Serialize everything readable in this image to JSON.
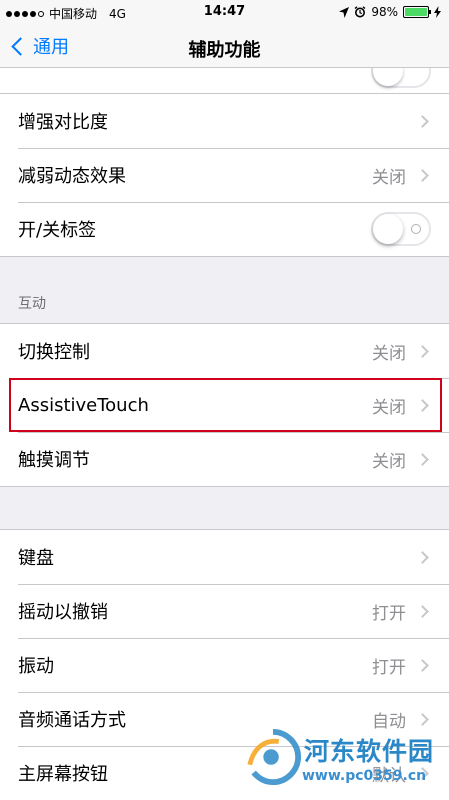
{
  "status_bar": {
    "carrier": "中国移动",
    "network": "4G",
    "time": "14:47",
    "battery_percent": "98%",
    "battery_level": 0.98
  },
  "nav": {
    "back_label": "通用",
    "title": "辅助功能"
  },
  "display_group": {
    "rows": [
      {
        "label": "增强对比度",
        "value": ""
      },
      {
        "label": "减弱动态效果",
        "value": "关闭"
      },
      {
        "label": "开/关标签",
        "toggle": false
      }
    ]
  },
  "interaction_group": {
    "header": "互动",
    "rows": [
      {
        "label": "切换控制",
        "value": "关闭"
      },
      {
        "label": "AssistiveTouch",
        "value": "关闭"
      },
      {
        "label": "触摸调节",
        "value": "关闭"
      }
    ]
  },
  "other_group": {
    "rows": [
      {
        "label": "键盘",
        "value": ""
      },
      {
        "label": "摇动以撤销",
        "value": "打开"
      },
      {
        "label": "振动",
        "value": "打开"
      },
      {
        "label": "音频通话方式",
        "value": "自动"
      },
      {
        "label": "主屏幕按钮",
        "value": "默认"
      }
    ]
  },
  "watermark": {
    "title": "河东软件园",
    "url": "www.pc0359.cn"
  },
  "colors": {
    "accent": "#007aff",
    "highlight_border": "#d0021b",
    "battery": "#4cd964"
  }
}
